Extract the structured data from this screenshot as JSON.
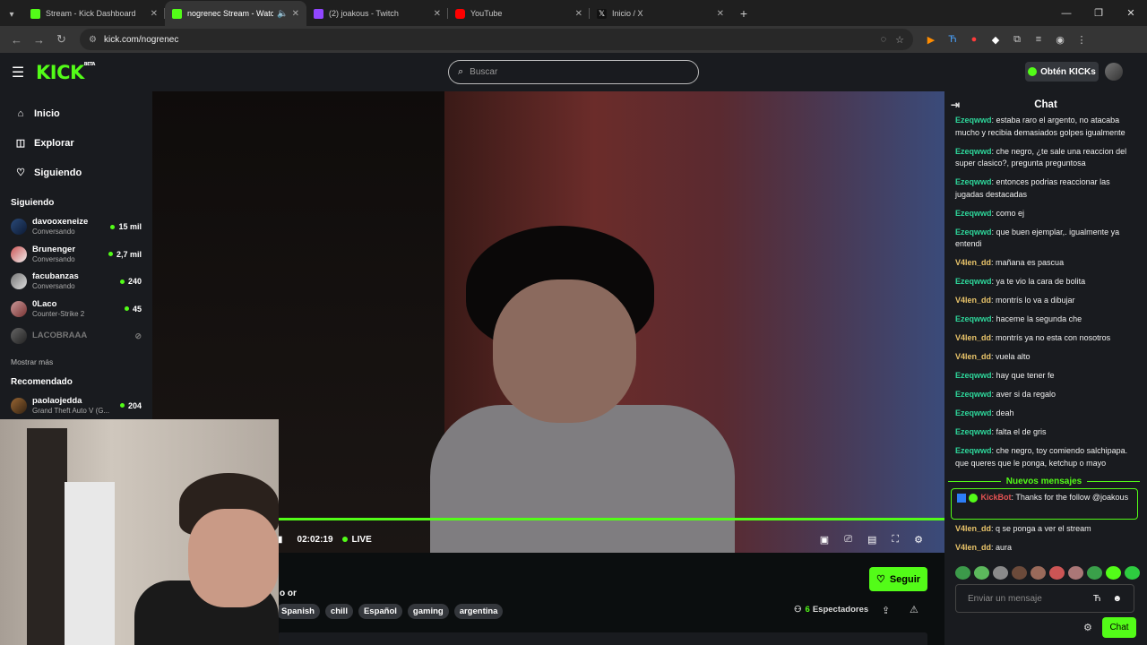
{
  "browser": {
    "tabs": [
      {
        "title": "Stream - Kick Dashboard",
        "color": "#53fc18"
      },
      {
        "title": "nogrenec Stream - Watch Li",
        "color": "#53fc18"
      },
      {
        "title": "(2) joakous - Twitch",
        "color": "#9146ff"
      },
      {
        "title": "YouTube",
        "color": "#ff0000"
      },
      {
        "title": "Inicio / X",
        "color": "#111111"
      }
    ],
    "url": "kick.com/nogrenec"
  },
  "header": {
    "logo": "KICK",
    "beta": "BETA",
    "search_placeholder": "Buscar",
    "kicks_label": "Obtén KICKs"
  },
  "sidebar": {
    "nav": [
      {
        "label": "Inicio",
        "icon": "home-icon"
      },
      {
        "label": "Explorar",
        "icon": "compass-icon"
      },
      {
        "label": "Siguiendo",
        "icon": "heart-icon"
      }
    ],
    "following_title": "Siguiendo",
    "following": [
      {
        "name": "davooxeneize",
        "sub": "Conversando",
        "viewers": "15 mil"
      },
      {
        "name": "Brunenger",
        "sub": "Conversando",
        "viewers": "2,7 mil"
      },
      {
        "name": "facubanzas",
        "sub": "Conversando",
        "viewers": "240"
      },
      {
        "name": "0Laco",
        "sub": "Counter-Strike 2",
        "viewers": "45"
      },
      {
        "name": "LACOBRAAA",
        "sub": "",
        "viewers": ""
      }
    ],
    "show_more": "Mostrar más",
    "recommended_title": "Recomendado",
    "recommended": [
      {
        "name": "paolaojedda",
        "sub": "Grand Theft Auto V (G...",
        "viewers": "204"
      }
    ]
  },
  "player": {
    "time": "02:02:19",
    "live": "LIVE"
  },
  "stream": {
    "title_fragment": "o or",
    "tags": [
      "Spanish",
      "chill",
      "Español",
      "gaming",
      "argentina"
    ],
    "viewers_count": "6",
    "viewers_label": "Espectadores",
    "follow_label": "Seguir"
  },
  "chat": {
    "title": "Chat",
    "messages": [
      {
        "user": "Ezeqwwd",
        "color": "green",
        "text": ": estaba raro el argento, no atacaba mucho y recibia demasiados golpes igualmente"
      },
      {
        "user": "Ezeqwwd",
        "color": "green",
        "text": ": che negro, ¿te sale una reaccion del super clasico?, pregunta preguntosa"
      },
      {
        "user": "Ezeqwwd",
        "color": "green",
        "text": ": entonces podrias reaccionar las jugadas destacadas"
      },
      {
        "user": "Ezeqwwd",
        "color": "green",
        "text": ": como ej"
      },
      {
        "user": "Ezeqwwd",
        "color": "green",
        "text": ": que buen ejemplar,. igualmente ya entendi"
      },
      {
        "user": "V4len_dd",
        "color": "yellow",
        "text": ": mañana es pascua"
      },
      {
        "user": "Ezeqwwd",
        "color": "green",
        "text": ": ya te vio la cara de bolita"
      },
      {
        "user": "V4len_dd",
        "color": "yellow",
        "text": ": montrís lo va a dibujar"
      },
      {
        "user": "Ezeqwwd",
        "color": "green",
        "text": ": haceme la segunda che"
      },
      {
        "user": "V4len_dd",
        "color": "yellow",
        "text": ": montrís ya no esta con nosotros"
      },
      {
        "user": "V4len_dd",
        "color": "yellow",
        "text": ": vuela alto"
      },
      {
        "user": "Ezeqwwd",
        "color": "green",
        "text": ": hay que tener fe"
      },
      {
        "user": "Ezeqwwd",
        "color": "green",
        "text": ": aver si da regalo"
      },
      {
        "user": "Ezeqwwd",
        "color": "green",
        "text": ": deah"
      },
      {
        "user": "Ezeqwwd",
        "color": "green",
        "text": ": falta el de gris"
      },
      {
        "user": "Ezeqwwd",
        "color": "green",
        "text": ": che negro, toy comiendo salchipapa. que queres que le ponga, ketchup o mayo"
      }
    ],
    "new_messages_label": "Nuevos mensajes",
    "bot_user": "KickBot",
    "bot_text": ": Thanks for the follow @joakous",
    "after": [
      {
        "user": "V4len_dd",
        "color": "yellow",
        "text": ": q se ponga a ver el stream"
      },
      {
        "user": "V4len_dd",
        "color": "yellow",
        "text": ": aura"
      }
    ],
    "input_placeholder": "Enviar un mensaje",
    "send_label": "Chat"
  }
}
